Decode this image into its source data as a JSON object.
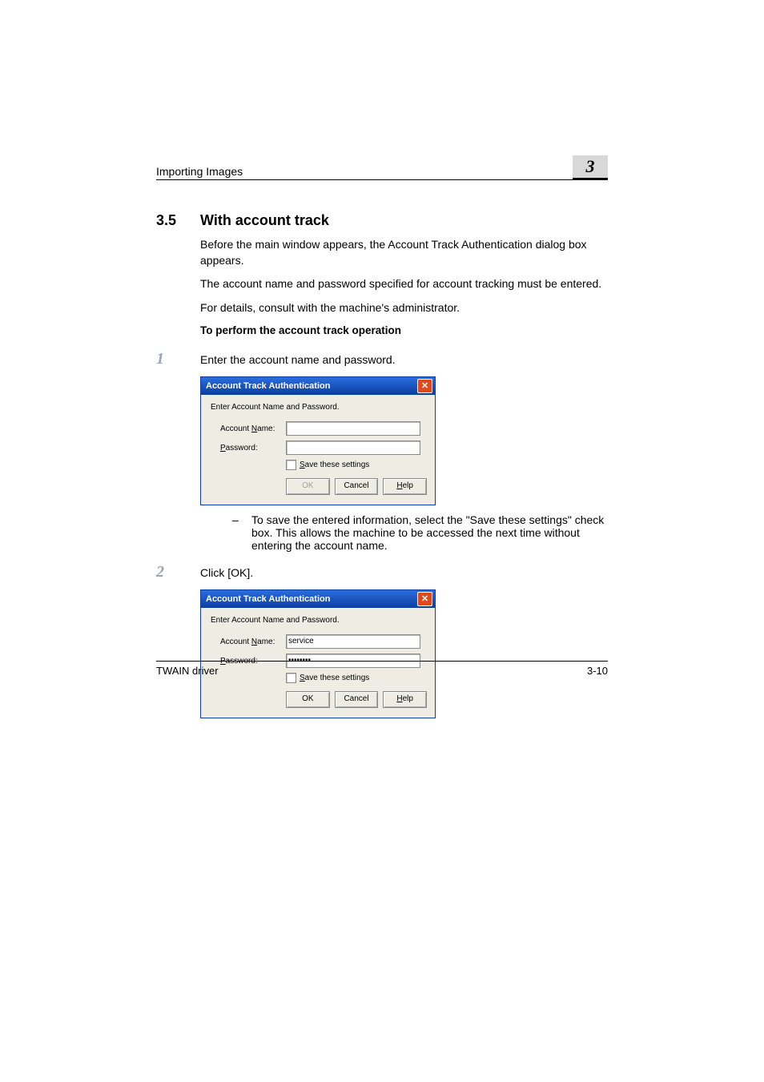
{
  "header": {
    "section": "Importing Images",
    "chapter_number": "3"
  },
  "heading": {
    "number": "3.5",
    "title": "With account track"
  },
  "paragraphs": {
    "p1": "Before the main window appears, the Account Track Authentication dialog box appears.",
    "p2": "The account name and password specified for account tracking must be entered.",
    "p3": "For details, consult with the machine's administrator.",
    "sub": "To perform the account track operation"
  },
  "steps": {
    "s1_num": "1",
    "s1_text": "Enter the account name and password.",
    "s1_note_dash": "–",
    "s1_note": "To save the entered information, select the \"Save these settings\" check box. This allows the machine to be accessed the next time without entering the account name.",
    "s2_num": "2",
    "s2_text": "Click [OK]."
  },
  "dialog": {
    "title": "Account Track Authentication",
    "close_glyph": "✕",
    "instr": "Enter Account Name and Password.",
    "account_label_prefix": "Account ",
    "account_label_u": "N",
    "account_label_suffix": "ame:",
    "password_label_u": "P",
    "password_label_suffix": "assword:",
    "save_label_u": "S",
    "save_label_suffix": "ave these settings",
    "ok_label": "OK",
    "cancel_label": "Cancel",
    "help_label_u": "H",
    "help_label_suffix": "elp",
    "values1": {
      "account": "",
      "password": ""
    },
    "values2": {
      "account": "service",
      "password": "••••••••"
    }
  },
  "footer": {
    "left": "TWAIN driver",
    "right": "3-10"
  }
}
